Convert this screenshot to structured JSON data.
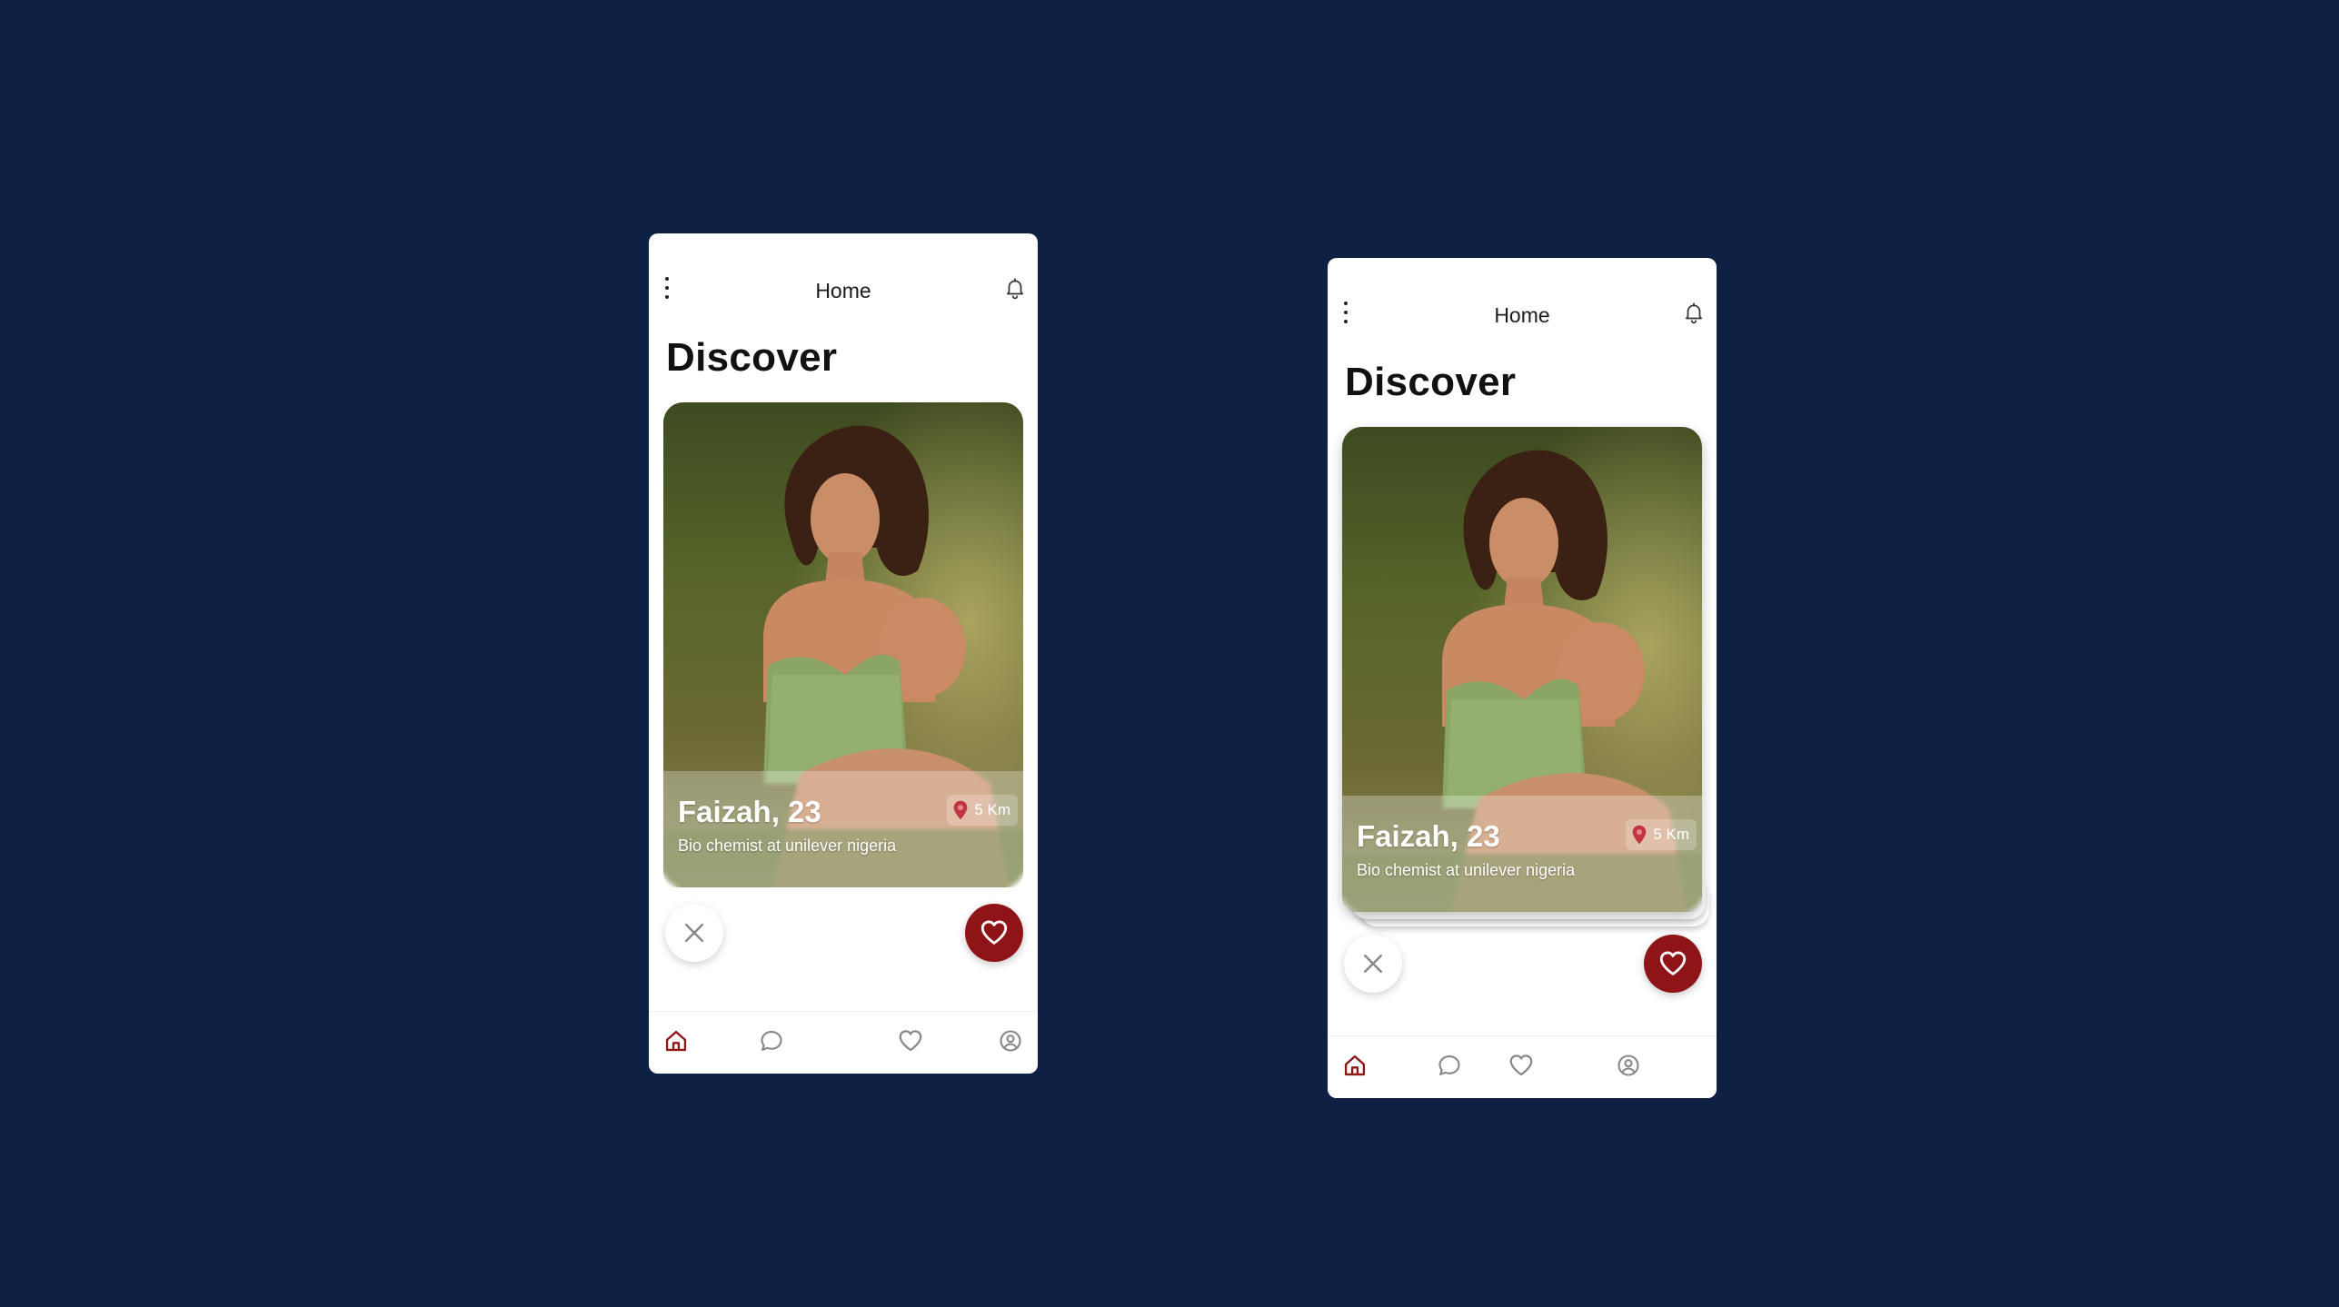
{
  "colors": {
    "background": "#0e2145",
    "accent": "#8f1417",
    "nav_inactive": "#888888"
  },
  "screens": [
    {
      "header": {
        "title": "Home",
        "menu_icon": "more-vertical-icon",
        "notification_icon": "bell-icon"
      },
      "heading": "Discover",
      "card": {
        "name": "Faizah, 23",
        "bio": "Bio chemist at unilever nigeria",
        "distance": "5 Km",
        "pin_icon": "location-pin-icon"
      },
      "actions": {
        "dislike_icon": "close-icon",
        "like_icon": "heart-icon"
      },
      "nav": [
        {
          "icon": "home-icon",
          "active": true
        },
        {
          "icon": "chat-icon",
          "active": false
        },
        {
          "icon": "heart-icon",
          "active": false
        },
        {
          "icon": "profile-icon",
          "active": false
        }
      ]
    },
    {
      "header": {
        "title": "Home",
        "menu_icon": "more-vertical-icon",
        "notification_icon": "bell-icon"
      },
      "heading": "Discover",
      "card": {
        "name": "Faizah, 23",
        "bio": "Bio chemist at unilever nigeria",
        "distance": "5 Km",
        "pin_icon": "location-pin-icon",
        "stacked": true
      },
      "actions": {
        "dislike_icon": "close-icon",
        "like_icon": "heart-icon"
      },
      "nav": [
        {
          "icon": "home-icon",
          "active": true
        },
        {
          "icon": "chat-icon",
          "active": false
        },
        {
          "icon": "heart-icon",
          "active": false
        },
        {
          "icon": "profile-icon",
          "active": false
        }
      ]
    }
  ]
}
